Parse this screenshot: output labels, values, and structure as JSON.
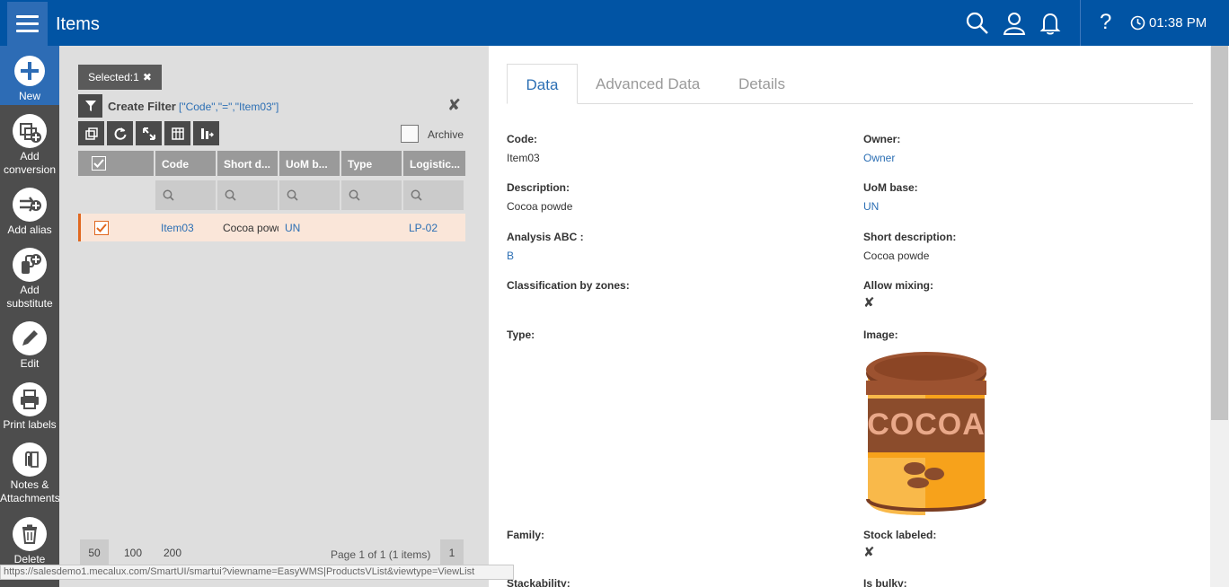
{
  "header": {
    "title": "Items",
    "time": "01:38 PM",
    "help": "?"
  },
  "toolbar": {
    "items": [
      {
        "label": "New",
        "icon": "plus-icon"
      },
      {
        "label": "Add conversion",
        "icon": "add-conversion-icon"
      },
      {
        "label": "Add alias",
        "icon": "add-alias-icon"
      },
      {
        "label": "Add substitute",
        "icon": "add-substitute-icon"
      },
      {
        "label": "Edit",
        "icon": "pencil-icon"
      },
      {
        "label": "Print labels",
        "icon": "printer-icon"
      },
      {
        "label": "Notes & Attachments",
        "icon": "paperclip-icon"
      },
      {
        "label": "Delete",
        "icon": "trash-icon"
      }
    ]
  },
  "list": {
    "selected": "Selected:1",
    "filter_label": "Create Filter",
    "filter_value": "[\"Code\",\"=\",\"Item03\"]",
    "archive_label": "Archive",
    "columns": [
      "Code",
      "Short d...",
      "UoM b...",
      "Type",
      "Logistic..."
    ],
    "rows": [
      {
        "code": "Item03",
        "short": "Cocoa powde",
        "uom": "UN",
        "type": "",
        "logistic": "LP-02"
      }
    ],
    "page_sizes": [
      "50",
      "100",
      "200"
    ],
    "page_info": "Page 1 of 1 (1 items)",
    "current_page": "1"
  },
  "status_url": "https://salesdemo1.mecalux.com/SmartUI/smartui?viewname=EasyWMS|ProductsVList&viewtype=ViewList",
  "detail": {
    "tabs": [
      "Data",
      "Advanced Data",
      "Details"
    ],
    "code_label": "Code:",
    "code_value": "Item03",
    "owner_label": "Owner:",
    "owner_value": "Owner",
    "description_label": "Description:",
    "description_value": "Cocoa powde",
    "uom_label": "UoM base:",
    "uom_value": "UN",
    "abc_label": "Analysis ABC :",
    "abc_value": "B",
    "short_label": "Short description:",
    "short_value": "Cocoa powde",
    "zones_label": "Classification by zones:",
    "mixing_label": "Allow mixing:",
    "type_label": "Type:",
    "image_label": "Image:",
    "image_text": "COCOA",
    "family_label": "Family:",
    "stock_label": "Stock labeled:",
    "stack_label": "Stackability:",
    "bulky_label": "Is bulky:"
  },
  "colors": {
    "header": "#0154a4",
    "accent": "#2c6fb4",
    "selection": "#e06820"
  }
}
